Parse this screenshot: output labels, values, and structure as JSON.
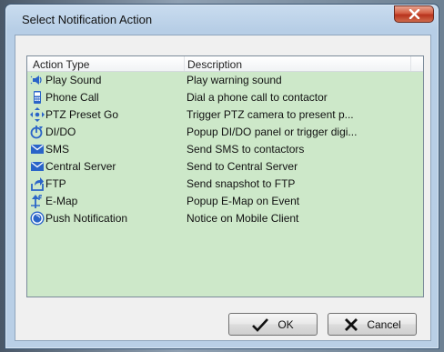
{
  "window": {
    "title": "Select Notification Action"
  },
  "list": {
    "columns": [
      "Action Type",
      "Description"
    ],
    "rows": [
      {
        "type": "Play Sound",
        "description": "Play warning sound",
        "icon": "speaker-icon"
      },
      {
        "type": "Phone Call",
        "description": "Dial a phone call to contactor",
        "icon": "phone-icon"
      },
      {
        "type": "PTZ Preset Go",
        "description": "Trigger PTZ camera to present p...",
        "icon": "ptz-arrows-icon"
      },
      {
        "type": "DI/DO",
        "description": "Popup DI/DO panel or trigger digi...",
        "icon": "dido-icon"
      },
      {
        "type": "SMS",
        "description": "Send SMS to contactors",
        "icon": "envelope-icon"
      },
      {
        "type": "Central Server",
        "description": "Send to Central Server",
        "icon": "envelope-icon"
      },
      {
        "type": "FTP",
        "description": "Send snapshot to FTP",
        "icon": "ftp-upload-icon"
      },
      {
        "type": "E-Map",
        "description": "Popup E-Map on Event",
        "icon": "map-pin-icon"
      },
      {
        "type": "Push Notification",
        "description": "Notice on Mobile Client",
        "icon": "push-notification-icon"
      }
    ]
  },
  "buttons": {
    "ok": "OK",
    "cancel": "Cancel"
  },
  "colors": {
    "list_background": "#cde8c9",
    "title_bar": "#b9cfe6",
    "close_button": "#c9462c"
  }
}
